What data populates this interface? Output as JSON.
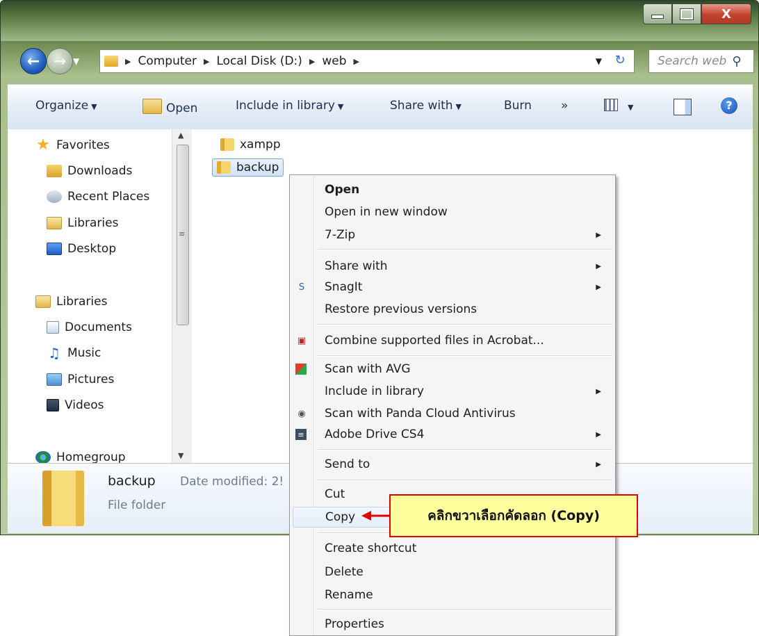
{
  "window": {
    "minimize_label": "—",
    "maximize_label": "",
    "close_label": "X"
  },
  "address": {
    "breadcrumbs": [
      "Computer",
      "Local Disk (D:)",
      "web"
    ],
    "search_placeholder": "Search web"
  },
  "toolbar": {
    "organize": "Organize",
    "open": "Open",
    "include_in_library": "Include in library",
    "share_with": "Share with",
    "burn": "Burn",
    "more": "»"
  },
  "nav": {
    "favorites": "Favorites",
    "downloads": "Downloads",
    "recent_places": "Recent Places",
    "libraries_fav": "Libraries",
    "desktop": "Desktop",
    "libraries": "Libraries",
    "documents": "Documents",
    "music": "Music",
    "pictures": "Pictures",
    "videos": "Videos",
    "homegroup": "Homegroup"
  },
  "files": [
    {
      "name": "xampp",
      "selected": false
    },
    {
      "name": "backup",
      "selected": true
    }
  ],
  "details": {
    "name": "backup",
    "date_modified": "Date modified: 2!",
    "type": "File folder"
  },
  "context_menu": {
    "open": "Open",
    "open_new_window": "Open in new window",
    "seven_zip": "7-Zip",
    "share_with": "Share with",
    "snagit": "SnagIt",
    "restore_versions": "Restore previous versions",
    "combine_acrobat": "Combine supported files in Acrobat...",
    "scan_avg": "Scan with AVG",
    "include_library": "Include in library",
    "scan_panda": "Scan with Panda Cloud Antivirus",
    "adobe_drive": "Adobe Drive CS4",
    "send_to": "Send to",
    "cut": "Cut",
    "copy": "Copy",
    "create_shortcut": "Create shortcut",
    "delete": "Delete",
    "rename": "Rename",
    "properties": "Properties"
  },
  "callout": {
    "text": "คลิกขวาเลือกคัดลอก (Copy)"
  },
  "colors": {
    "callout_bg": "#ffff9e",
    "callout_border": "#e30000",
    "arrow": "#e30000"
  }
}
